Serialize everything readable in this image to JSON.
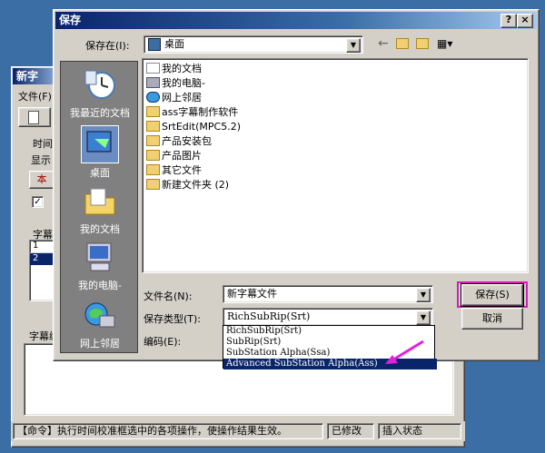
{
  "background_window": {
    "title": "新字",
    "menu_file": "文件(F)",
    "label_time": "时间",
    "label_display": "显示",
    "label_local": "本",
    "label_check": "✓",
    "label_subtitle": "字幕",
    "label_subtitle_edit": "字幕编",
    "table_rows": [
      "1",
      "2"
    ]
  },
  "dialog": {
    "title": "保存",
    "help_btn": "?",
    "close_btn": "×",
    "save_in_label": "保存在(I):",
    "save_in_value": "桌面",
    "places": [
      {
        "label": "我最近的文档",
        "icon": "recent-docs-icon"
      },
      {
        "label": "桌面",
        "icon": "desktop-icon"
      },
      {
        "label": "我的文档",
        "icon": "my-documents-icon"
      },
      {
        "label": "我的电脑-",
        "icon": "my-computer-icon"
      },
      {
        "label": "网上邻居",
        "icon": "network-icon"
      }
    ],
    "files": [
      {
        "name": "我的文档",
        "icon": "documents-folder-icon"
      },
      {
        "name": "我的电脑-",
        "icon": "computer-icon"
      },
      {
        "name": "网上邻居",
        "icon": "network-icon"
      },
      {
        "name": "ass字幕制作软件",
        "icon": "folder-icon"
      },
      {
        "name": "SrtEdit(MPC5.2)",
        "icon": "folder-icon"
      },
      {
        "name": "产品安装包",
        "icon": "folder-icon"
      },
      {
        "name": "产品图片",
        "icon": "folder-icon"
      },
      {
        "name": "其它文件",
        "icon": "folder-icon"
      },
      {
        "name": "新建文件夹 (2)",
        "icon": "folder-icon"
      }
    ],
    "filename_label": "文件名(N):",
    "filename_value": "新字幕文件",
    "filetype_label": "保存类型(T):",
    "filetype_value": "RichSubRip(Srt)",
    "encoding_label": "编码(E):",
    "save_button": "保存(S)",
    "cancel_button": "取消",
    "filetype_options": [
      "RichSubRip(Srt)",
      "SubRip(Srt)",
      "SubStation Alpha(Ssa)",
      "Advanced SubStation Alpha(Ass)"
    ],
    "selected_option_index": 3
  },
  "statusbar": {
    "command": "【命令】执行时间校准框选中的各项操作，使操作结果生效。",
    "modified": "已修改",
    "insert_state": "插入状态"
  },
  "colors": {
    "desktop": "#3a6ea5",
    "highlight": "#0a246a",
    "annotation_arrow": "#e020e0",
    "annotation_box": "#d020c0"
  }
}
